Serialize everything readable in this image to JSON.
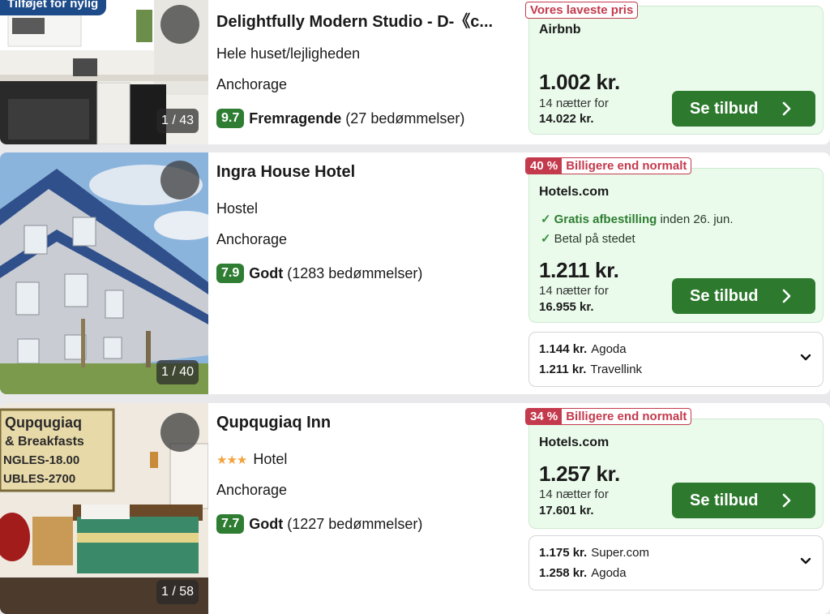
{
  "listings": [
    {
      "recent_badge": "Tilføjet for nylig",
      "photo_counter": "1 / 43",
      "title": "Delightfully Modern Studio - D-《c...",
      "type": "Hele huset/lejligheden",
      "city": "Anchorage",
      "score": "9.7",
      "rating_word": "Fremragende",
      "reviews": "(27 bedømmelser)",
      "badge_label": "Vores laveste pris",
      "provider": "Airbnb",
      "price": "1.002 kr.",
      "nights": "14 nætter for",
      "total": "14.022 kr.",
      "button": "Se tilbud"
    },
    {
      "photo_counter": "1 / 40",
      "title": "Ingra House Hotel",
      "type": "Hostel",
      "city": "Anchorage",
      "score": "7.9",
      "rating_word": "Godt",
      "reviews": "(1283 bedømmelser)",
      "badge_pct": "40 %",
      "badge_label": "Billigere end normalt",
      "provider": "Hotels.com",
      "feature1_bold": "Gratis afbestilling",
      "feature1_rest": "inden 26. jun.",
      "feature2": "Betal på stedet",
      "price": "1.211 kr.",
      "nights": "14 nætter for",
      "total": "16.955 kr.",
      "button": "Se tilbud",
      "other_offers": [
        {
          "price": "1.144 kr.",
          "site": "Agoda"
        },
        {
          "price": "1.211 kr.",
          "site": "Travellink"
        }
      ]
    },
    {
      "photo_counter": "1 / 58",
      "title": "Qupqugiaq Inn",
      "stars": "★★★",
      "type": "Hotel",
      "city": "Anchorage",
      "score": "7.7",
      "rating_word": "Godt",
      "reviews": "(1227 bedømmelser)",
      "badge_pct": "34 %",
      "badge_label": "Billigere end normalt",
      "provider": "Hotels.com",
      "price": "1.257 kr.",
      "nights": "14 nætter for",
      "total": "17.601 kr.",
      "button": "Se tilbud",
      "other_offers": [
        {
          "price": "1.175 kr.",
          "site": "Super.com"
        },
        {
          "price": "1.258 kr.",
          "site": "Agoda"
        }
      ]
    }
  ],
  "colors": {
    "green_button": "#2d7a2e",
    "score_green": "#2e7d32",
    "deal_bg": "#eafbeb",
    "badge_red": "#c43a4d",
    "recent_blue": "#1d4b8a"
  },
  "icons": {
    "favorite": "heart-icon",
    "cta": "chevron-right-icon",
    "expand": "chevron-down-icon",
    "feature": "checkmark-icon",
    "rating": "star-icon"
  }
}
